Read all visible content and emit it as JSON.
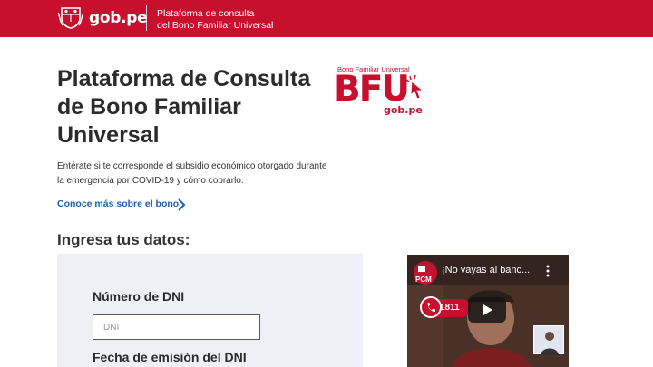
{
  "header": {
    "brand": "gob.pe",
    "subtitle_line1": "Plataforma de consulta",
    "subtitle_line2": "del Bono Familiar Universal",
    "color": "#c8102e"
  },
  "hero": {
    "title": "Plataforma de Consulta de Bono Familiar Universal",
    "description": "Entérate si te corresponde el subsidio económico otorgado durante la emergencia por COVID-19 y cómo cobrarlo.",
    "link_label": "Conoce más sobre el bono"
  },
  "logo": {
    "caption": "Bono Familiar Universal",
    "acronym": "BFU",
    "site": "gob.pe"
  },
  "form": {
    "heading": "Ingresa tus datos:",
    "dni_label": "Número de DNI",
    "dni_placeholder": "DNI",
    "fecha_label": "Fecha de emisión del DNI"
  },
  "video": {
    "title": "¡No vayas al banc...",
    "channel_badge": "PCM",
    "phone_number": "1811",
    "icons": [
      "play-icon",
      "more-vert-icon",
      "phone-icon",
      "sign-language-icon"
    ]
  },
  "colors": {
    "brand_red": "#c8102e",
    "link_blue": "#1f5fb0",
    "panel_bg": "#eef0f6"
  }
}
